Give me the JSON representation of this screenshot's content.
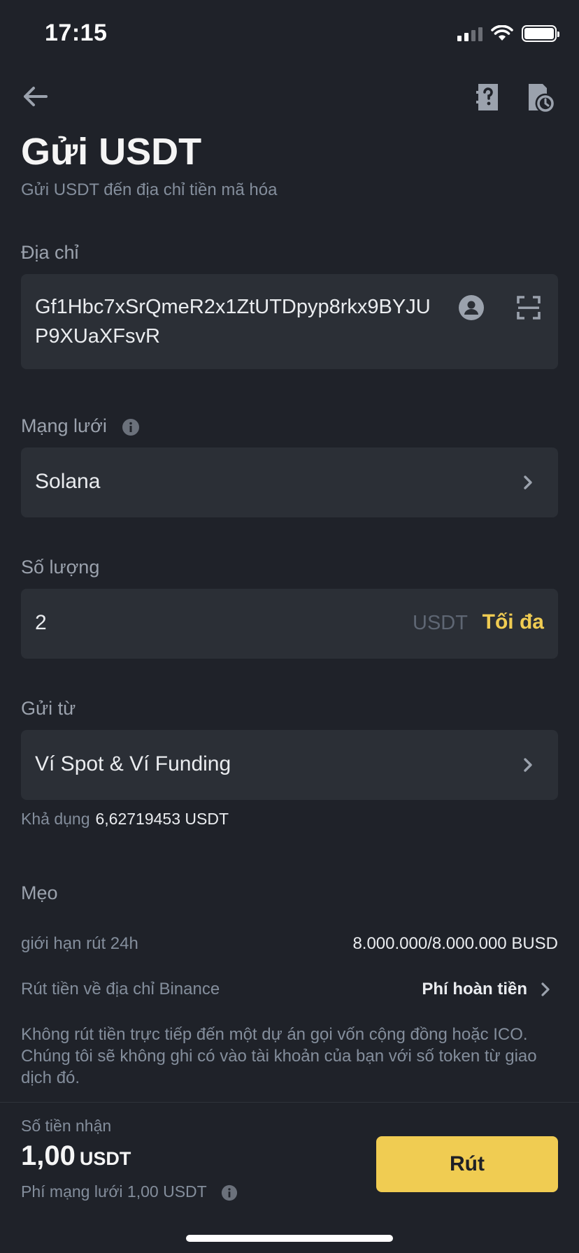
{
  "status_bar": {
    "time": "17:15"
  },
  "header": {
    "title": "Gửi USDT",
    "subtitle": "Gửi USDT đến địa chỉ tiền mã hóa"
  },
  "address": {
    "label": "Địa chỉ",
    "value": "Gf1Hbc7xSrQmeR2x1ZtUTDpyp8rkx9BYJUP9XUaXFsvR"
  },
  "network": {
    "label": "Mạng lưới",
    "value": "Solana"
  },
  "amount": {
    "label": "Số lượng",
    "value": "2",
    "unit": "USDT",
    "max_label": "Tối đa"
  },
  "send_from": {
    "label": "Gửi từ",
    "value": "Ví Spot & Ví Funding",
    "available_label": "Khả dụng",
    "available_value": "6,62719453 USDT"
  },
  "tips": {
    "title": "Mẹo",
    "limit_label": "giới hạn rút 24h",
    "limit_value": "8.000.000/8.000.000 BUSD",
    "binance_label": "Rút tiền về địa chỉ Binance",
    "binance_value": "Phí hoàn tiền",
    "notice": "Không rút tiền trực tiếp đến một dự án gọi vốn cộng đồng hoặc ICO. Chúng tôi sẽ không ghi có vào tài khoản của bạn với số token từ giao dịch đó."
  },
  "footer": {
    "receive_label": "Số tiền nhận",
    "receive_amount": "1,00",
    "receive_unit": "USDT",
    "fee_text": "Phí mạng lưới 1,00 USDT",
    "withdraw_button": "Rút"
  },
  "colors": {
    "accent": "#f0cc52",
    "background": "#1f2229",
    "field": "#2b2f36"
  }
}
